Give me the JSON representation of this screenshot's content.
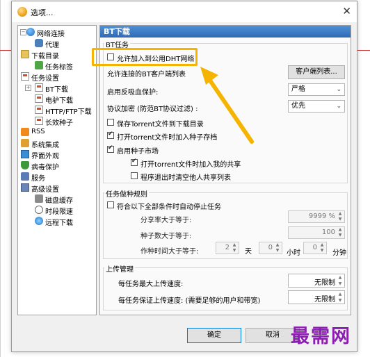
{
  "window": {
    "title": "选项...",
    "close_icon": "✕"
  },
  "tree": {
    "items": [
      {
        "label": "网络连接",
        "icon": "globe-icon",
        "expander": "−"
      },
      {
        "label": "代理",
        "icon": "proxy-icon"
      },
      {
        "label": "下载目录",
        "icon": "folder-icon"
      },
      {
        "label": "任务标签",
        "icon": "tag-icon"
      },
      {
        "label": "任务设置",
        "icon": "task-icon"
      },
      {
        "label": "BT下载",
        "icon": "doc-icon",
        "expander": "+"
      },
      {
        "label": "电驴下载",
        "icon": "doc-icon"
      },
      {
        "label": "HTTP/FTP下载",
        "icon": "doc-icon"
      },
      {
        "label": "长效种子",
        "icon": "doc-icon"
      },
      {
        "label": "RSS",
        "icon": "rss-icon"
      },
      {
        "label": "系统集成",
        "icon": "puzzle-icon"
      },
      {
        "label": "界面外观",
        "icon": "monitor-icon"
      },
      {
        "label": "病毒保护",
        "icon": "shield-icon"
      },
      {
        "label": "服务",
        "icon": "service-icon"
      },
      {
        "label": "高级设置",
        "icon": "advanced-icon",
        "expander": "−"
      },
      {
        "label": "磁盘缓存",
        "icon": "disk-icon"
      },
      {
        "label": "时段限速",
        "icon": "clock-icon"
      },
      {
        "label": "远程下载",
        "icon": "remote-icon"
      }
    ]
  },
  "panel": {
    "header": "BT下载",
    "bt_task": {
      "group_label": "BT任务",
      "dht_label": "允许加入到公用DHT网络",
      "dht_checked": false,
      "client_list_label": "允许连接的BT客户端列表",
      "client_list_button": "客户端列表...",
      "anti_leech_label": "启用反吸血保护:",
      "anti_leech_value": "严格",
      "encryption_label": "协议加密 (防范BT协议过滤) :",
      "encryption_value": "优先",
      "save_torrent_label": "保存Torrent文件到下载目录",
      "save_torrent_checked": false,
      "open_torrent_label": "打开torrent文件时加入种子存档",
      "open_torrent_checked": true,
      "seed_market_label": "启用种子市场",
      "seed_market_checked": true,
      "share_label": "打开torrent文件时加入我的共享",
      "share_checked": true,
      "clear_share_label": "程序退出时清空他人共享列表",
      "clear_share_checked": false
    },
    "seeding": {
      "group_label": "任务做种规则",
      "auto_stop_label": "符合以下全部条件时自动停止任务",
      "auto_stop_checked": false,
      "ratio_label": "分享率大于等于:",
      "ratio_value": "9999 %",
      "seeds_label": "种子数大于等于:",
      "seeds_value": "100",
      "time_label": "作种时间大于等于:",
      "days_value": "2",
      "days_unit": "天",
      "hours_value": "0",
      "hours_unit": "小时",
      "minutes_value": "0",
      "minutes_unit": "分钟"
    },
    "upload": {
      "group_label": "上传管理",
      "max_speed_label": "每任务最大上传速度:",
      "max_speed_value": "无限制",
      "guarantee_label": "每任务保证上传速度: (需要足够的用户和带宽)",
      "guarantee_value": "无限制"
    }
  },
  "footer": {
    "ok_label": "确定",
    "cancel_label": "取消"
  },
  "watermark": "最需网",
  "colors": {
    "header_blue": "#2f6bb5",
    "highlight": "#f5b400",
    "arrow": "#f5b400",
    "watermark": "#8a1eb0"
  }
}
